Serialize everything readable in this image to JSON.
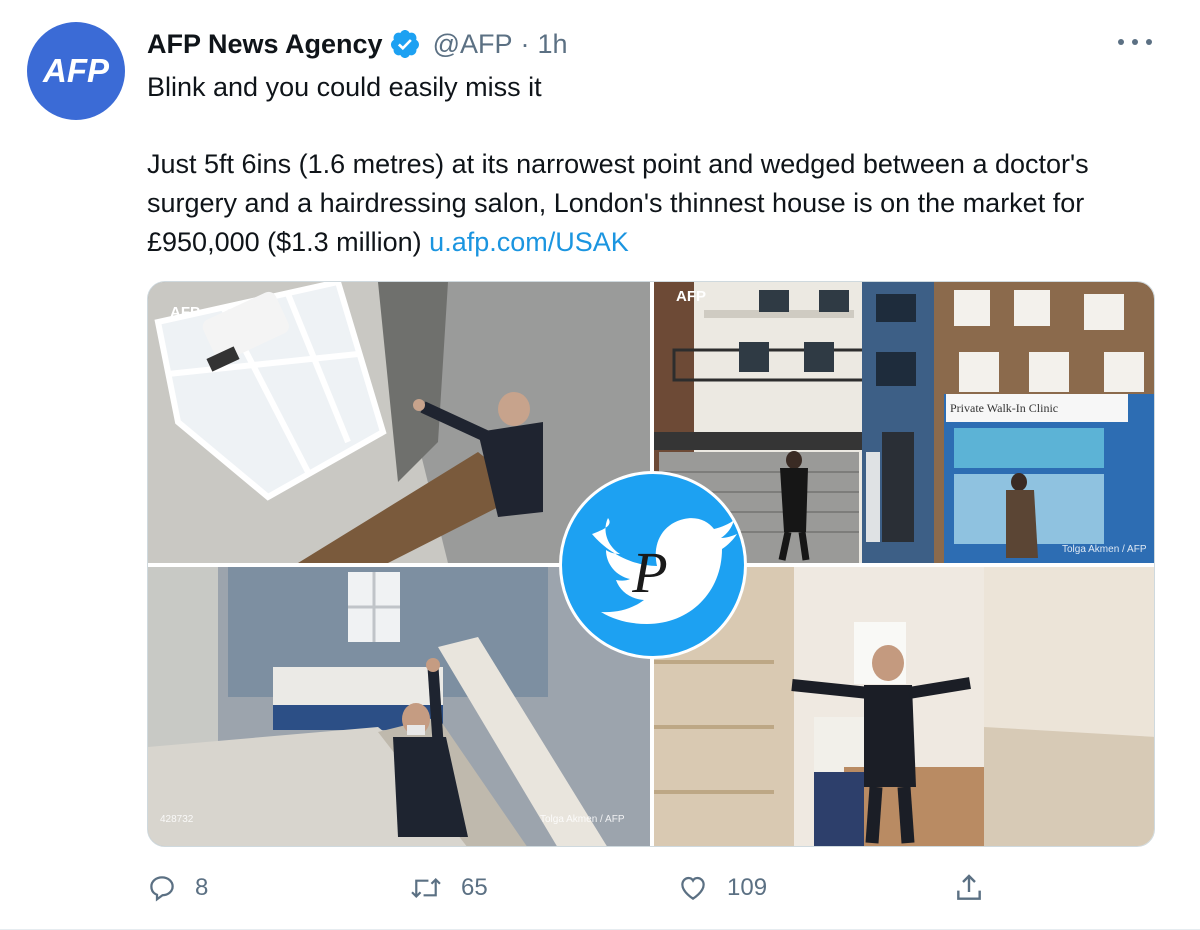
{
  "tweet": {
    "avatar_text": "AFP",
    "display_name": "AFP News Agency",
    "handle": "@AFP",
    "separator": "·",
    "time": "1h",
    "text_line1": "Blink and you could easily miss it",
    "text_body": "Just 5ft 6ins (1.6 metres) at its narrowest point and wedged between a doctor's surgery and a hairdressing salon, London's thinnest house is on the market for £950,000 ($1.3 million) ",
    "link": "u.afp.com/USAK",
    "accent_color": "#1b95e0",
    "brand_color": "#3b6bd6"
  },
  "media": {
    "photo1_watermark": "AFP",
    "photo2_watermark": "AFP",
    "photo2_sign": "Private Walk-In Clinic",
    "photo2_credit": "Tolga Akmen / AFP",
    "photo3_corner": "428732",
    "photo3_credit": "Tolga Akmen / AFP",
    "overlay_icon": "twitter-bird-icon"
  },
  "actions": {
    "reply_count": "8",
    "retweet_count": "65",
    "like_count": "109"
  }
}
